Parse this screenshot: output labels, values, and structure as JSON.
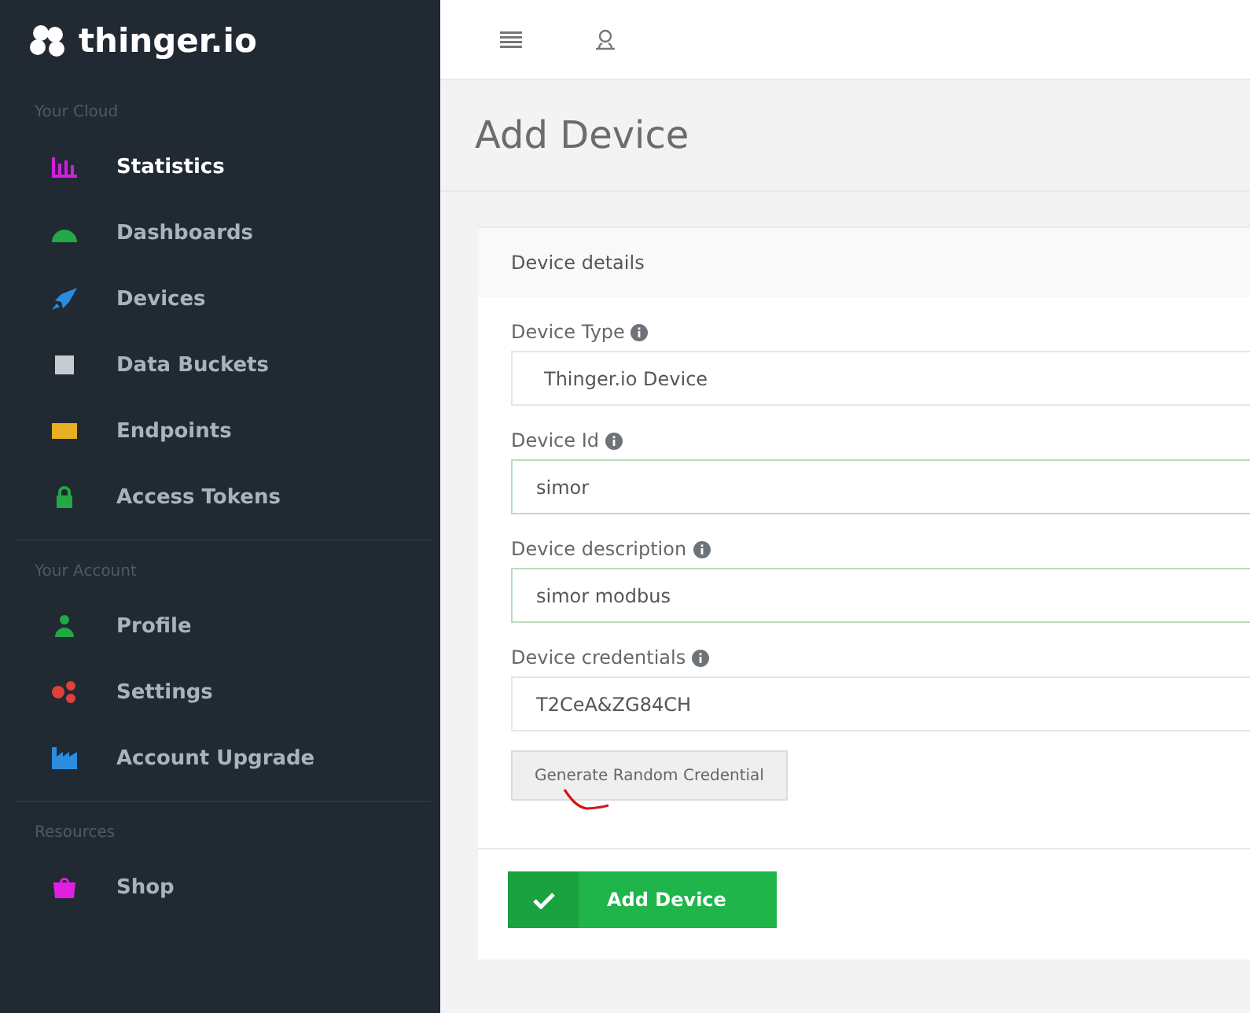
{
  "sidebar": {
    "logo": "thinger.io",
    "sections": [
      {
        "title": "Your Cloud",
        "items": [
          {
            "label": "Statistics",
            "kind": "chart",
            "color": "#d21ee0",
            "selected": true
          },
          {
            "label": "Dashboards",
            "kind": "gauge",
            "color": "#22a845",
            "selected": false
          },
          {
            "label": "Devices",
            "kind": "rocket",
            "color": "#2a8de0",
            "selected": false
          },
          {
            "label": "Data Buckets",
            "kind": "database",
            "color": "#c8ccd0",
            "selected": false
          },
          {
            "label": "Endpoints",
            "kind": "card",
            "color": "#e8b020",
            "selected": false
          },
          {
            "label": "Access Tokens",
            "kind": "lock",
            "color": "#22a845",
            "selected": false
          }
        ]
      },
      {
        "title": "Your Account",
        "items": [
          {
            "label": "Profile",
            "kind": "person",
            "color": "#22a845",
            "selected": false
          },
          {
            "label": "Settings",
            "kind": "gears",
            "color": "#e0403a",
            "selected": false
          },
          {
            "label": "Account Upgrade",
            "kind": "factory",
            "color": "#2a8de0",
            "selected": false
          }
        ]
      },
      {
        "title": "Resources",
        "items": [
          {
            "label": "Shop",
            "kind": "bag",
            "color": "#e020e0",
            "selected": false
          }
        ]
      }
    ]
  },
  "page": {
    "title": "Add Device"
  },
  "panel": {
    "title": "Device details",
    "fields": [
      {
        "label": "Device Type",
        "kind": "select",
        "value": "Thinger.io Device",
        "valid": false
      },
      {
        "label": "Device Id",
        "kind": "text",
        "value": "simor",
        "valid": true
      },
      {
        "label": "Device description",
        "kind": "text",
        "value": "simor modbus",
        "valid": true
      },
      {
        "label": "Device credentials",
        "kind": "text",
        "value": "T2CeA&ZG84CH",
        "valid": false
      }
    ],
    "generate_button": "Generate Random Credential",
    "submit_button": "Add Device"
  }
}
